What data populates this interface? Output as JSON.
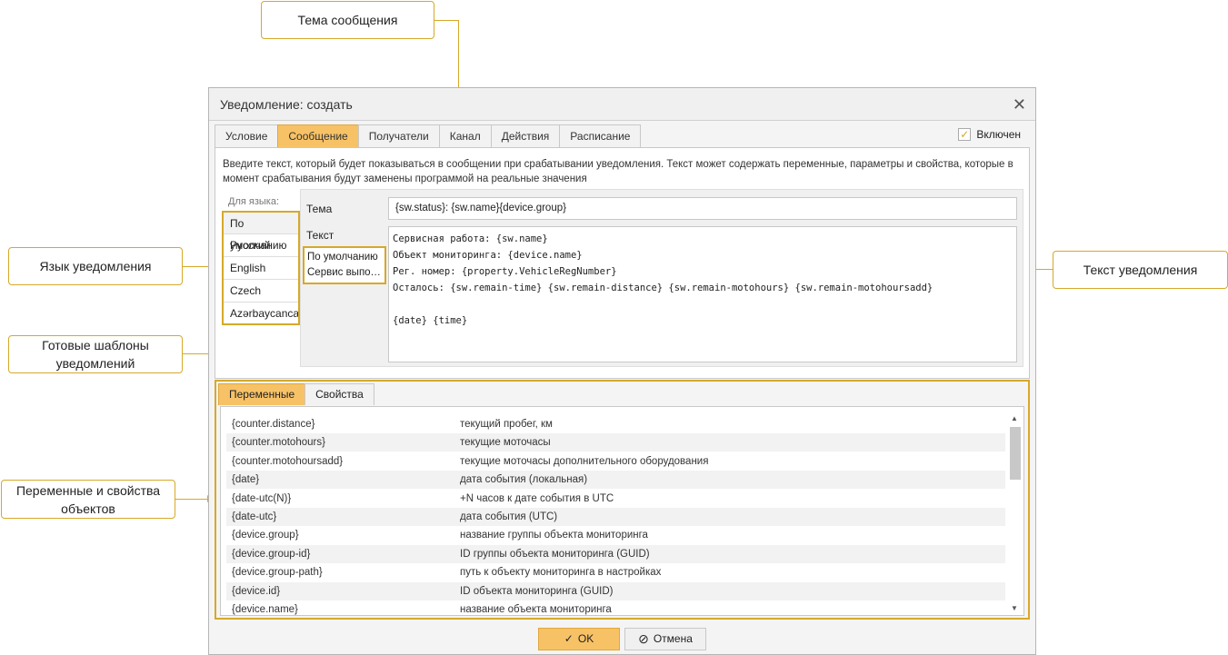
{
  "callouts": {
    "subject": "Тема сообщения",
    "language": "Язык уведомления",
    "templates": "Готовые шаблоны уведомлений",
    "text": "Текст уведомления",
    "variables": "Переменные и свойства объектов"
  },
  "dialog": {
    "title": "Уведомление: создать",
    "tabs": [
      "Условие",
      "Сообщение",
      "Получатели",
      "Канал",
      "Действия",
      "Расписание"
    ],
    "enabled_label": "Включен",
    "description": "Введите текст, который будет показываться в сообщении при срабатывании уведомления. Текст может содержать переменные, параметры и свойства, которые в момент срабатывания будут заменены программой на реальные значения",
    "for_language": "Для языка:",
    "languages": [
      "По умолчанию",
      "Русский",
      "English",
      "Czech",
      "Azərbaycanca"
    ],
    "subject_label": "Тема",
    "text_label": "Текст",
    "subject_value": "{sw.status}: {sw.name}{device.group}",
    "body_value": "Сервисная работа: {sw.name}\nОбъект мониторинга: {device.name}\nРег. номер: {property.VehicleRegNumber}\nОсталось: {sw.remain-time} {sw.remain-distance} {sw.remain-motohours} {sw.remain-motohoursadd}\n\n{date} {time}",
    "templates": [
      "По умолчанию",
      "Сервис выполн..."
    ],
    "var_tabs": [
      "Переменные",
      "Свойства"
    ],
    "variables": [
      {
        "name": "{counter.distance}",
        "desc": "текущий пробег, км"
      },
      {
        "name": "{counter.motohours}",
        "desc": "текущие моточасы"
      },
      {
        "name": "{counter.motohoursadd}",
        "desc": "текущие моточасы дополнительного оборудования"
      },
      {
        "name": "{date}",
        "desc": "дата события (локальная)"
      },
      {
        "name": "{date-utc(N)}",
        "desc": "+N часов к дате события в UTC"
      },
      {
        "name": "{date-utc}",
        "desc": "дата события (UTC)"
      },
      {
        "name": "{device.group}",
        "desc": "название группы объекта мониторинга"
      },
      {
        "name": "{device.group-id}",
        "desc": "ID группы объекта мониторинга (GUID)"
      },
      {
        "name": "{device.group-path}",
        "desc": "путь к объекту мониторинга в настройках"
      },
      {
        "name": "{device.id}",
        "desc": "ID объекта мониторинга (GUID)"
      },
      {
        "name": "{device.name}",
        "desc": "название объекта мониторинга"
      }
    ],
    "ok_label": "OK",
    "cancel_label": "Отмена"
  },
  "colors": {
    "accent": "#f7c266",
    "callout_line": "#d6a92a"
  }
}
